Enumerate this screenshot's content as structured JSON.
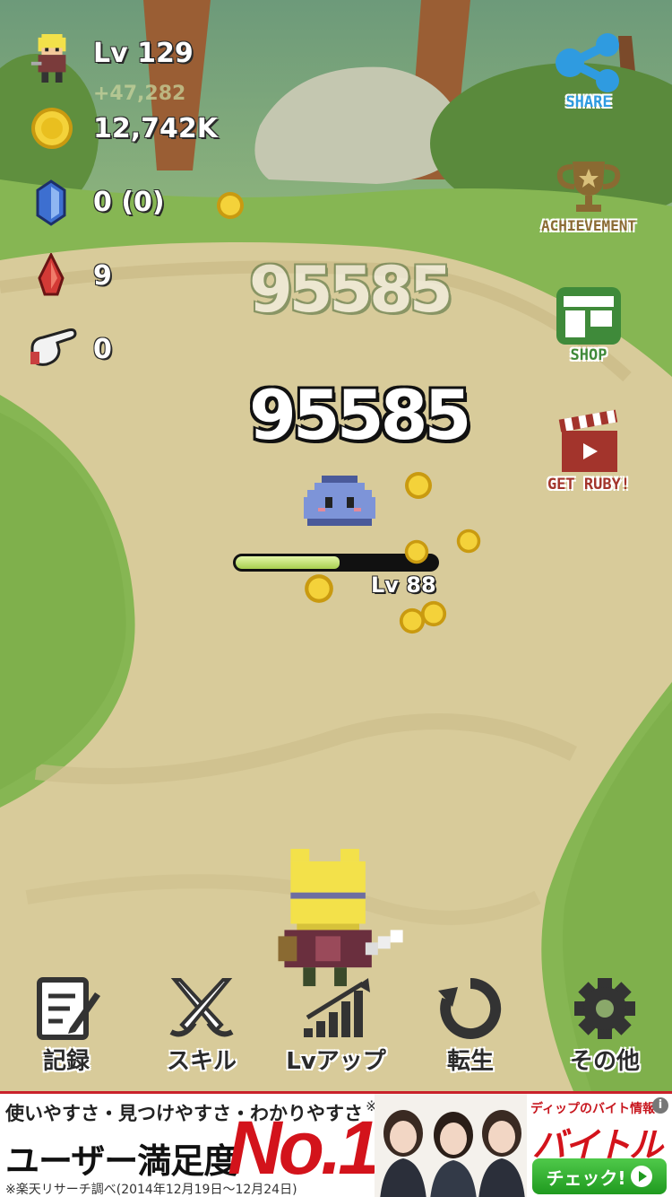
{
  "hud": {
    "level": "Lv 129",
    "level_gain": "+47,282",
    "gold": "12,742K",
    "crystals": "0 (0)",
    "ruby": "9",
    "taps": "0"
  },
  "side_buttons": {
    "share": "SHARE",
    "achievement": "ACHIEVEMENT",
    "shop": "SHOP",
    "get_ruby": "GET RUBY!"
  },
  "battle": {
    "damage_ghost": "95585",
    "damage": "95585",
    "enemy_level": "Lv 88",
    "enemy_hp_fraction": 0.52
  },
  "menu": {
    "records": "記録",
    "skill": "スキル",
    "level_up": "Lvアップ",
    "rebirth": "転生",
    "other": "その他"
  },
  "ad": {
    "tagline": "使いやすさ・見つけやすさ・わかりやすさ",
    "asterisk": "※",
    "headline": "ユーザー満足度",
    "no1": "No.1",
    "note": "※楽天リサーチ調べ(2014年12月19日〜12月24日)",
    "brand_small": "ディップのバイト情報",
    "brand": "バイトル",
    "cta": "チェック!",
    "info": "i"
  },
  "colors": {
    "grass": "#7fae54",
    "path": "#d8cb9a",
    "shop_green": "#3f8a3a",
    "ruby_red": "#a3342c",
    "share_blue": "#2f9be0",
    "achievement_brown": "#8a6a32"
  }
}
